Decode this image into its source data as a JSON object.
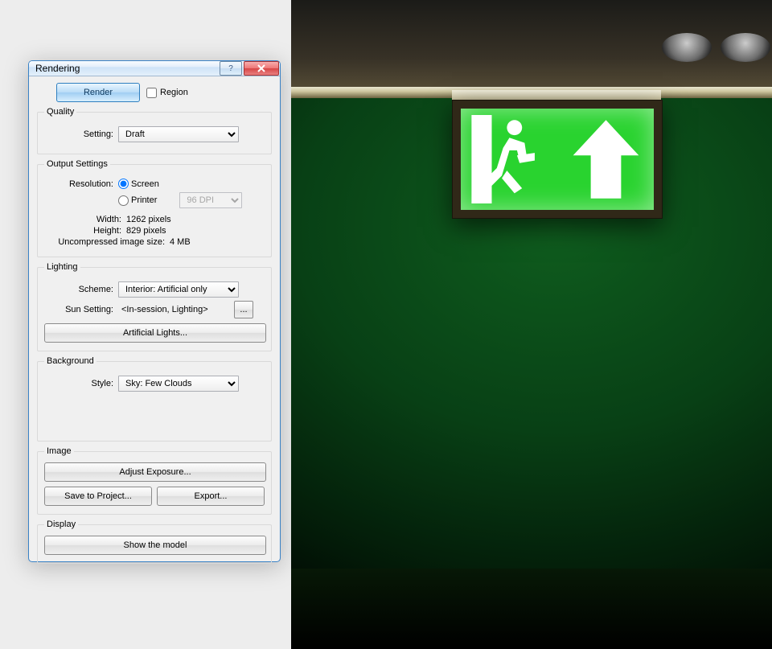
{
  "dialog": {
    "title": "Rendering",
    "renderButton": "Render",
    "regionCheckbox": "Region",
    "quality": {
      "legend": "Quality",
      "settingLabel": "Setting:",
      "settingValue": "Draft"
    },
    "output": {
      "legend": "Output Settings",
      "resolutionLabel": "Resolution:",
      "screenOption": "Screen",
      "printerOption": "Printer",
      "dpiValue": "96 DPI",
      "widthLabel": "Width:",
      "widthValue": "1262 pixels",
      "heightLabel": "Height:",
      "heightValue": "829 pixels",
      "uncompressedLabel": "Uncompressed image size:",
      "uncompressedValue": "4 MB"
    },
    "lighting": {
      "legend": "Lighting",
      "schemeLabel": "Scheme:",
      "schemeValue": "Interior: Artificial only",
      "sunLabel": "Sun Setting:",
      "sunValue": "<In-session, Lighting>",
      "browseBtn": "...",
      "artificialBtn": "Artificial Lights..."
    },
    "background": {
      "legend": "Background",
      "styleLabel": "Style:",
      "styleValue": "Sky: Few Clouds"
    },
    "image": {
      "legend": "Image",
      "exposureBtn": "Adjust Exposure...",
      "saveBtn": "Save to Project...",
      "exportBtn": "Export..."
    },
    "display": {
      "legend": "Display",
      "showModelBtn": "Show the model"
    }
  }
}
